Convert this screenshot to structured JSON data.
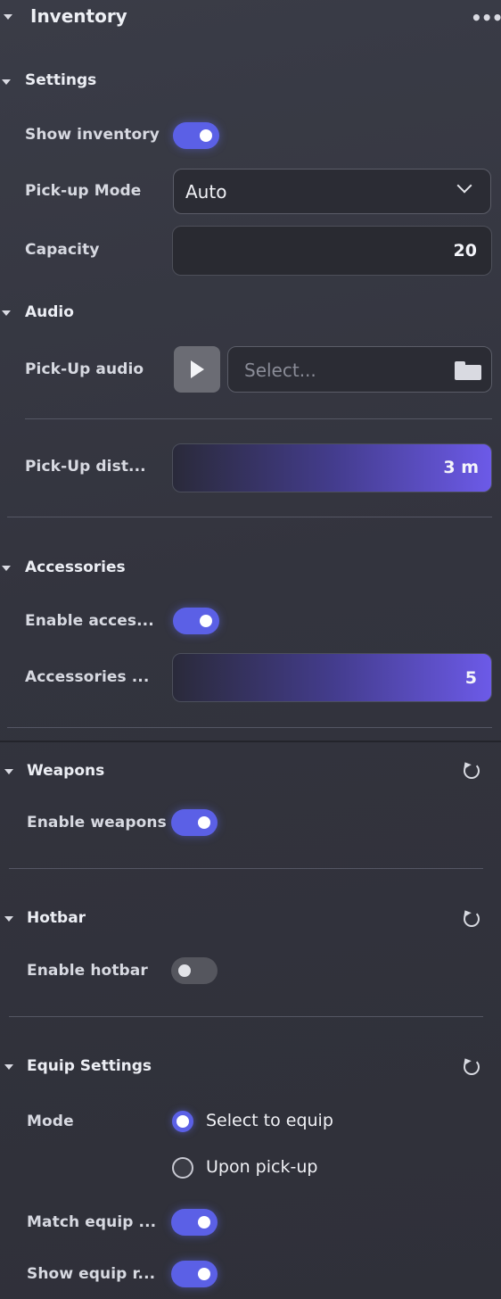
{
  "panel": {
    "title": "Inventory",
    "more_icon": "more-dots-icon"
  },
  "settings": {
    "heading": "Settings",
    "show_inventory": {
      "label": "Show inventory",
      "on": true
    },
    "pickup_mode": {
      "label": "Pick-up Mode",
      "value": "Auto"
    },
    "capacity": {
      "label": "Capacity",
      "value": "20"
    }
  },
  "audio": {
    "heading": "Audio",
    "pickup_audio": {
      "label": "Pick-Up audio",
      "placeholder": "Select..."
    },
    "pickup_distance": {
      "label": "Pick-Up dist...",
      "value": "3 m"
    }
  },
  "accessories": {
    "heading": "Accessories",
    "enable": {
      "label": "Enable acces...",
      "on": true
    },
    "count": {
      "label": "Accessories ...",
      "value": "5"
    }
  },
  "weapons": {
    "heading": "Weapons",
    "enable": {
      "label": "Enable weapons",
      "on": true
    }
  },
  "hotbar": {
    "heading": "Hotbar",
    "enable": {
      "label": "Enable hotbar",
      "on": false
    }
  },
  "equip": {
    "heading": "Equip Settings",
    "mode_label": "Mode",
    "options": [
      "Select to equip",
      "Upon pick-up"
    ],
    "selected": "Select to equip",
    "match": {
      "label": "Match equip ...",
      "on": true
    },
    "show": {
      "label": "Show equip r...",
      "on": true
    }
  },
  "colors": {
    "accent": "#5b60e6",
    "panel_bg": "#35363f"
  }
}
